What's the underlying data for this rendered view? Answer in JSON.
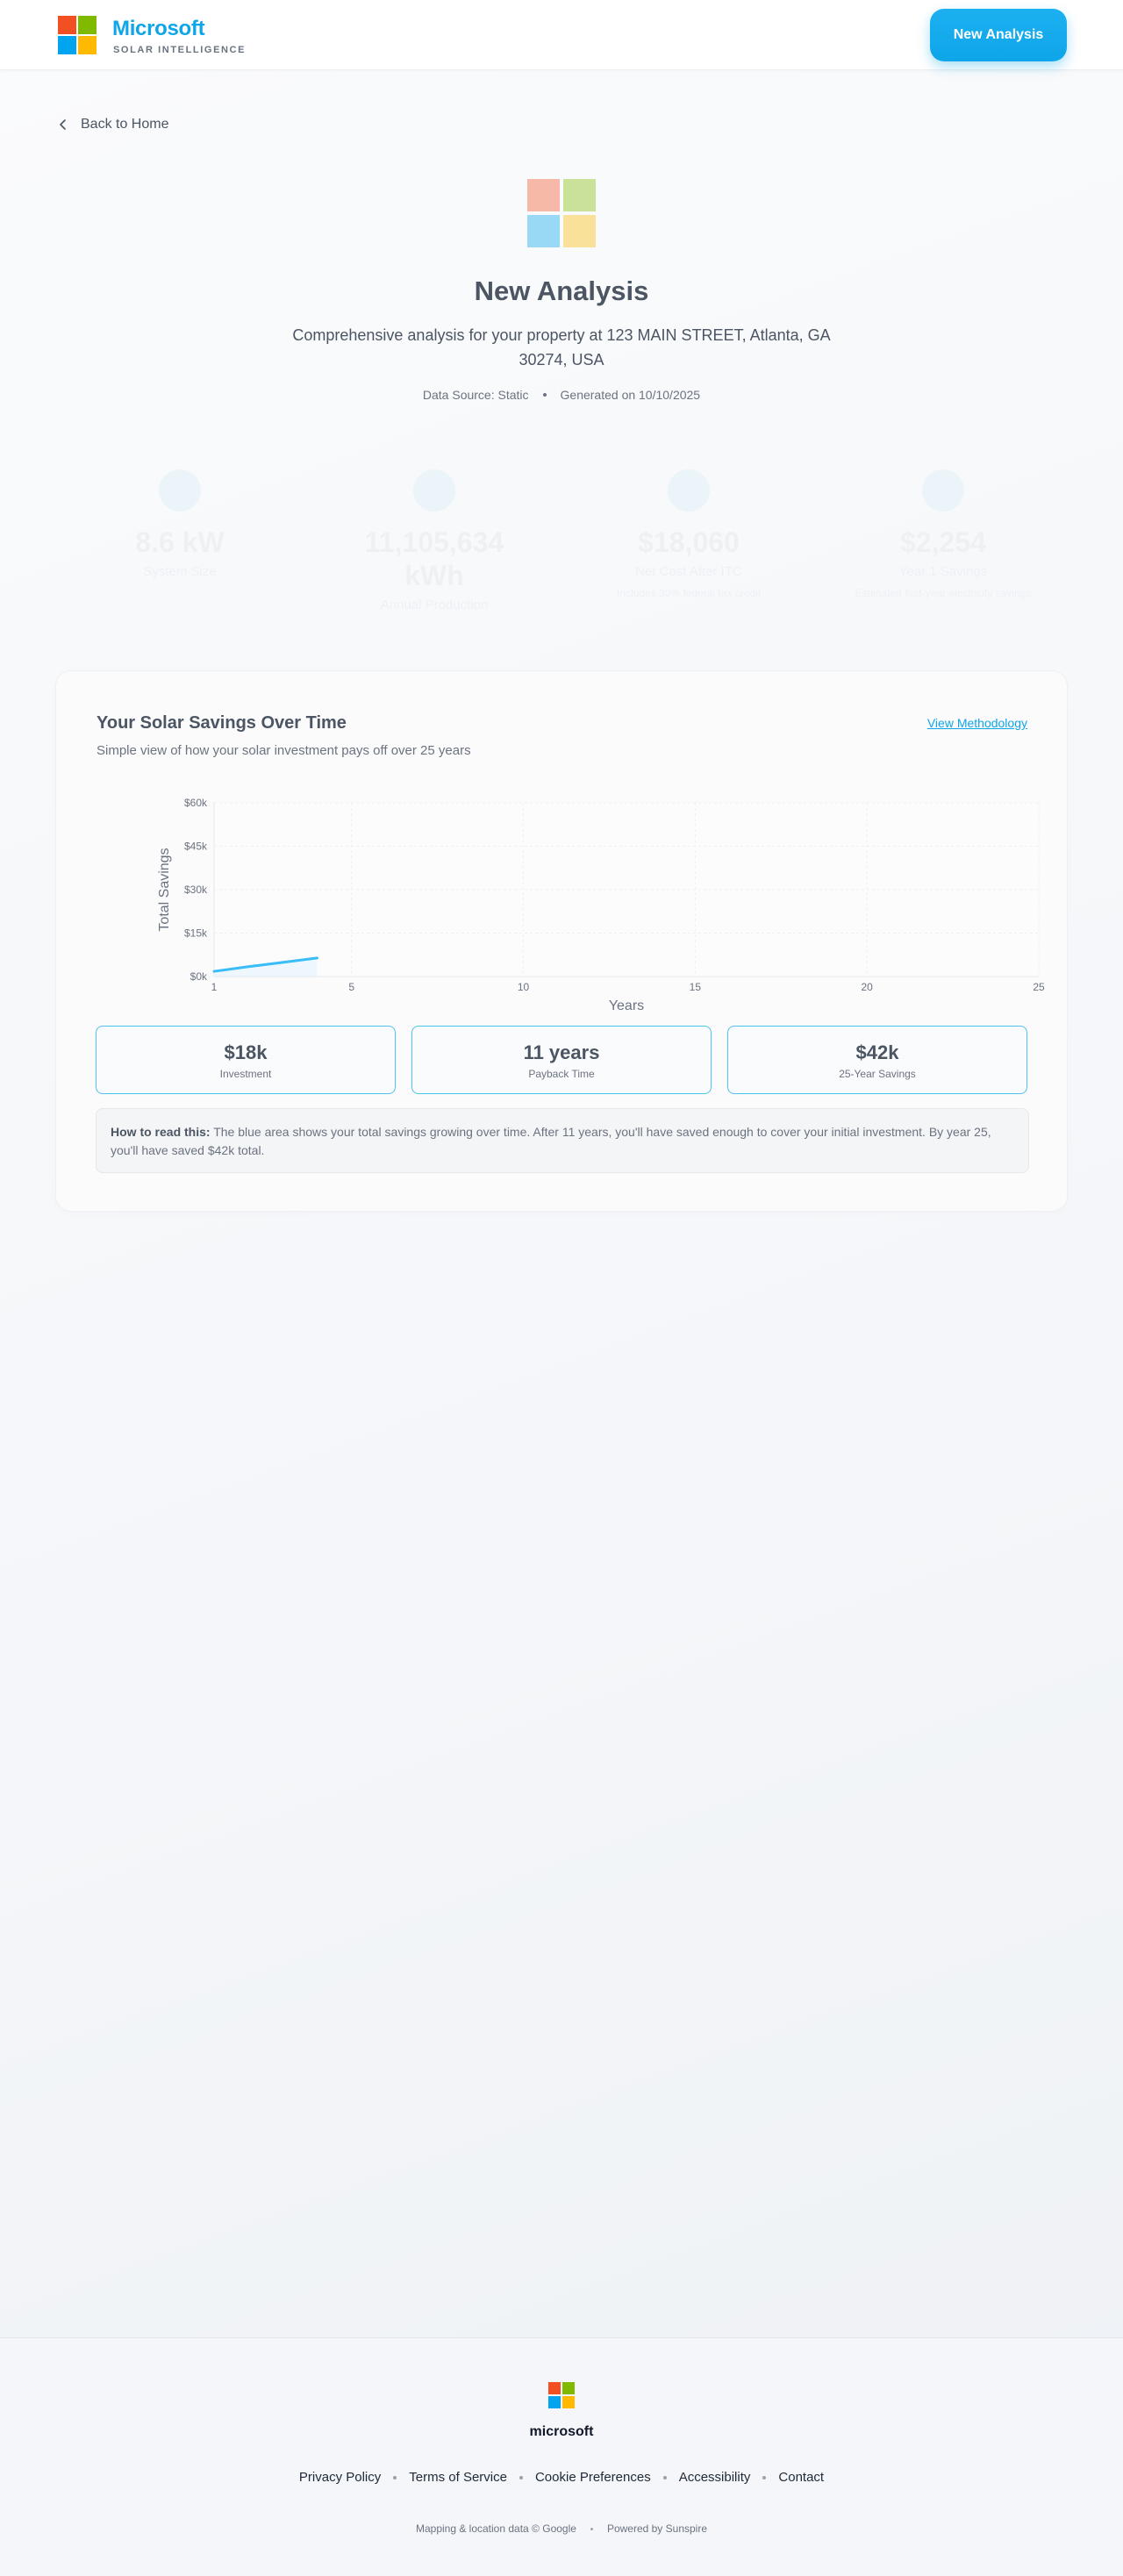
{
  "header": {
    "brand_name": "Microsoft",
    "brand_sub": "SOLAR INTELLIGENCE",
    "new_analysis_label": "New Analysis"
  },
  "colors": {
    "accent": "#0ea5e9",
    "logo_red": "#f25022",
    "logo_green": "#7fba00",
    "logo_blue": "#00a4ef",
    "logo_yellow": "#ffb900"
  },
  "nav": {
    "back_label": "Back to Home",
    "back_icon": "chevron-left-icon"
  },
  "hero": {
    "title": "New Analysis",
    "subtitle": "Comprehensive analysis for your property at 123 MAIN STREET, Atlanta, GA 30274, USA",
    "data_source": "Data Source: Static",
    "generated": "Generated on 10/10/2025"
  },
  "metrics": [
    {
      "value": "8.6 kW",
      "label": "System Size",
      "note": ""
    },
    {
      "value": "11,105,634 kWh",
      "label": "Annual Production",
      "note": ""
    },
    {
      "value": "$18,060",
      "label": "Net Cost After ITC",
      "note": "Includes 30% federal tax credit"
    },
    {
      "value": "$2,254",
      "label": "Year 1 Savings",
      "note": "Estimated first-year electricity savings"
    }
  ],
  "savings_card": {
    "title": "Your Solar Savings Over Time",
    "methodology_link": "View Methodology",
    "subtitle": "Simple view of how your solar investment pays off over 25 years",
    "stats": [
      {
        "value": "$18k",
        "label": "Investment"
      },
      {
        "value": "11 years",
        "label": "Payback Time"
      },
      {
        "value": "$42k",
        "label": "25-Year Savings"
      }
    ],
    "howto_bold": "How to read this:",
    "howto_text": " The blue area shows your total savings growing over time. After 11 years, you'll have saved enough to cover your initial investment. By year 25, you'll have saved $42k total."
  },
  "chart_data": {
    "type": "area",
    "title": "",
    "xlabel": "Years",
    "ylabel": "Total Savings",
    "x_ticks": [
      1,
      5,
      10,
      15,
      20,
      25
    ],
    "y_ticks": [
      "$0k",
      "$15k",
      "$30k",
      "$45k",
      "$60k"
    ],
    "xlim": [
      1,
      25
    ],
    "ylim": [
      0,
      60000
    ],
    "grid": true,
    "series": [
      {
        "x": [
          1,
          2,
          3,
          4
        ],
        "values": [
          1800,
          3400,
          4900,
          6400
        ]
      }
    ]
  },
  "footer": {
    "name": "microsoft",
    "links": [
      "Privacy Policy",
      "Terms of Service",
      "Cookie Preferences",
      "Accessibility",
      "Contact"
    ],
    "credit_1": "Mapping & location data © Google",
    "credit_2": "Powered by Sunspire"
  }
}
